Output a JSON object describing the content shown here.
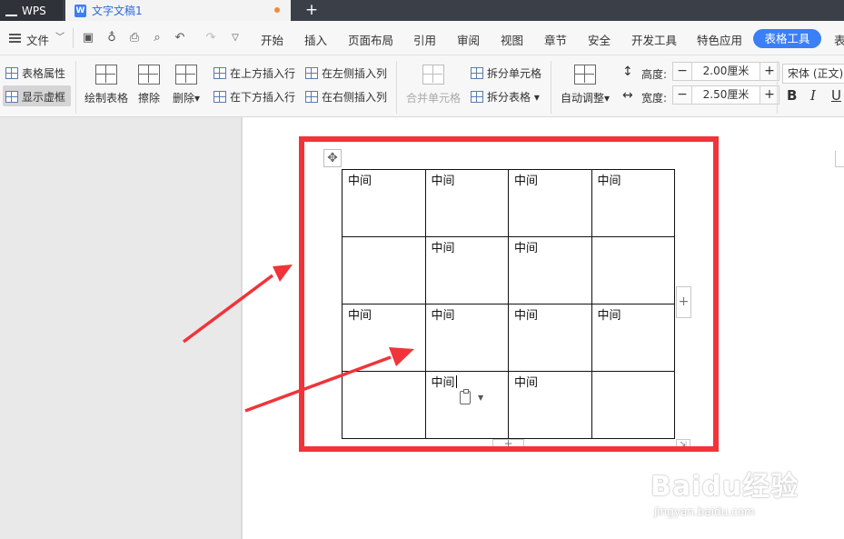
{
  "titlebar": {
    "app_tab": "WPS",
    "doc_tab": "文字文稿1",
    "doc_icon": "W"
  },
  "menu": {
    "file": "文件",
    "items": [
      "开始",
      "插入",
      "页面布局",
      "引用",
      "审阅",
      "视图",
      "章节",
      "安全",
      "开发工具",
      "特色应用"
    ],
    "active": "表格工具",
    "overflow": "表"
  },
  "ribbon": {
    "table_props": "表格属性",
    "show_gridlines": "显示虚框",
    "draw_table": "绘制表格",
    "erase": "擦除",
    "delete": "删除",
    "insert_row_above": "在上方插入行",
    "insert_row_below": "在下方插入行",
    "insert_col_left": "在左侧插入列",
    "insert_col_right": "在右侧插入列",
    "merge_cells": "合并单元格",
    "split_cells": "拆分单元格",
    "split_table": "拆分表格",
    "auto_fit": "自动调整",
    "height_label": "高度:",
    "height_value": "2.00厘米",
    "width_label": "宽度:",
    "width_value": "2.50厘米",
    "font_name": "宋体 (正文)",
    "bold": "B",
    "italic": "I",
    "underline": "U"
  },
  "table": {
    "rows": [
      [
        "中间",
        "中间",
        "中间",
        "中间"
      ],
      [
        "",
        "中间",
        "中间",
        ""
      ],
      [
        "中间",
        "中间",
        "中间",
        "中间"
      ],
      [
        "",
        "中间",
        "中间",
        ""
      ]
    ]
  },
  "colors": {
    "accent": "#3a7ff6",
    "highlight_frame": "#f0343a",
    "arrow": "#f0343a"
  },
  "watermark": {
    "brand": "Baidu经验",
    "url": "jingyan.baidu.com"
  }
}
